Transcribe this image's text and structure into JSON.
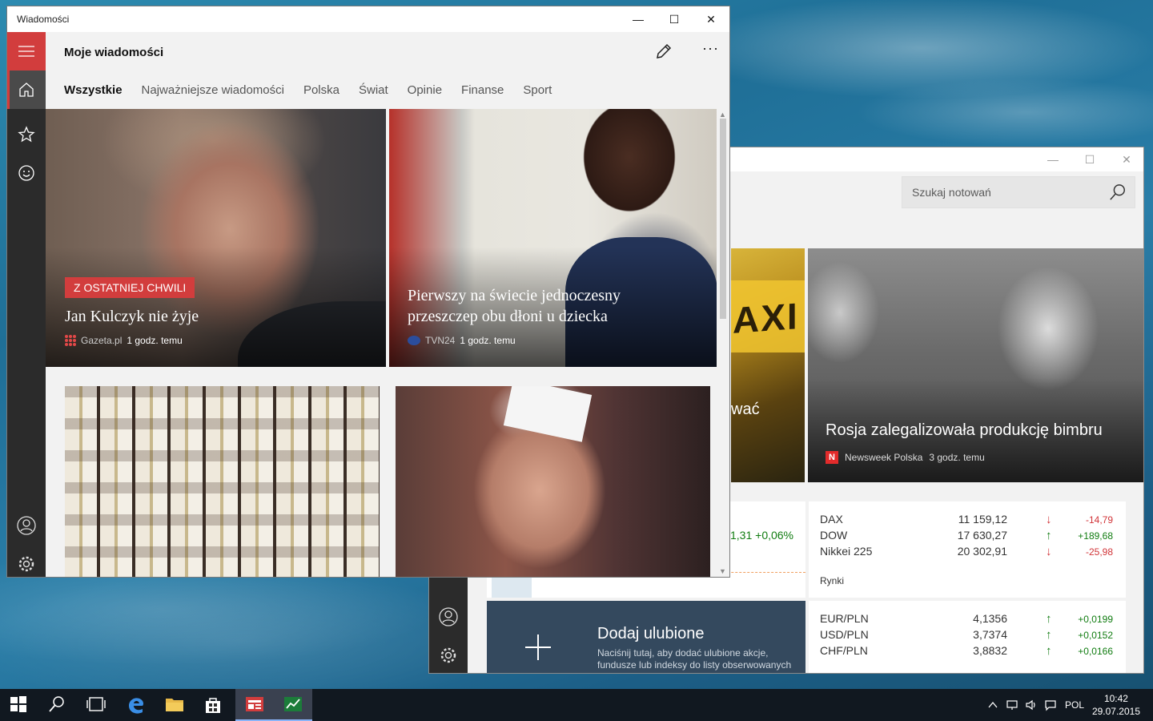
{
  "news_window": {
    "title": "Wiadomości",
    "app_title": "Moje wiadomości",
    "window_controls": {
      "minimize": "—",
      "maximize": "☐",
      "close": "✕"
    },
    "more_label": "···",
    "tabs": [
      "Wszystkie",
      "Najważniejsze wiadomości",
      "Polska",
      "Świat",
      "Opinie",
      "Finanse",
      "Sport"
    ],
    "active_tab": "Wszystkie",
    "sidebar": [
      "hamburger-menu-icon",
      "home-icon",
      "interests-icon",
      "emoji-icon",
      "user-icon",
      "settings-icon"
    ],
    "hero1": {
      "badge": "Z OSTATNIEJ CHWILI",
      "title": "Jan Kulczyk nie żyje",
      "source": "Gazeta.pl",
      "time": "1 godz. temu"
    },
    "hero2": {
      "title": "Pierwszy na świecie jednoczesny przeszczep obu dłoni u dziecka",
      "source": "TVN24",
      "time": "1 godz. temu"
    }
  },
  "finance_window": {
    "search_placeholder": "Szukaj notowań",
    "hero_a_fragment": "wać",
    "hero_b": {
      "title": "Rosja zalegalizowała produkcję bimbru",
      "source": "Newsweek Polska",
      "time": "3 godz. temu"
    },
    "partial_value": "1,31 +0,06%",
    "markets": {
      "rows": [
        {
          "name": "DAX",
          "value": "11 159,12",
          "dir": "down",
          "change": "-14,79"
        },
        {
          "name": "DOW",
          "value": "17 630,27",
          "dir": "up",
          "change": "+189,68"
        },
        {
          "name": "Nikkei 225",
          "value": "20 302,91",
          "dir": "down",
          "change": "-25,98"
        }
      ],
      "footer": "Rynki"
    },
    "currency": {
      "rows": [
        {
          "name": "EUR/PLN",
          "value": "4,1356",
          "dir": "up",
          "change": "+0,0199"
        },
        {
          "name": "USD/PLN",
          "value": "3,7374",
          "dir": "up",
          "change": "+0,0152"
        },
        {
          "name": "CHF/PLN",
          "value": "3,8832",
          "dir": "up",
          "change": "+0,0166"
        }
      ]
    },
    "add_favorites": {
      "title": "Dodaj ulubione",
      "subtitle": "Naciśnij tutaj, aby dodać ulubione akcje, fundusze lub indeksy do listy obserwowanych"
    }
  },
  "taskbar": {
    "items": [
      "start-icon",
      "search-icon",
      "task-view-icon",
      "edge-icon",
      "file-explorer-icon",
      "store-icon",
      "news-app-icon",
      "money-app-icon"
    ],
    "language": "POL",
    "time": "10:42",
    "date": "29.07.2015"
  },
  "colors": {
    "accent_red": "#d23d3d",
    "up": "#107c10",
    "down": "#d13438",
    "finance_tile": "#34495e"
  }
}
